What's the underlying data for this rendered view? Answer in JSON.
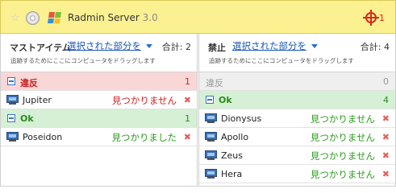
{
  "titlebar": {
    "app_name": "Radmin Server",
    "version": "3.0",
    "alert_count": "1"
  },
  "left_panel": {
    "label": "マストアイテム",
    "select_link": "選択された部分を",
    "total": "合計: 2",
    "hint": "追跡するためにここにコンピュータをドラッグします",
    "groups": [
      {
        "name": "違反",
        "count": "1",
        "items": [
          {
            "name": "Jupiter",
            "status": "見つかりません"
          }
        ]
      },
      {
        "name": "Ok",
        "count": "1",
        "items": [
          {
            "name": "Poseidon",
            "status": "見つかりました"
          }
        ]
      }
    ]
  },
  "right_panel": {
    "label": "禁止",
    "select_link": "選択された部分を",
    "total": "合計: 4",
    "hint": "追跡するためにここにコンピュータをドラッグします",
    "groups": [
      {
        "name": "違反",
        "count": "0",
        "items": []
      },
      {
        "name": "Ok",
        "count": "4",
        "items": [
          {
            "name": "Dionysus",
            "status": "見つかりません"
          },
          {
            "name": "Apollo",
            "status": "見つかりません"
          },
          {
            "name": "Zeus",
            "status": "見つかりません"
          },
          {
            "name": "Hera",
            "status": "見つかりません"
          }
        ]
      }
    ]
  },
  "icons": {
    "favorite": "star-icon",
    "server": "disc-icon",
    "os": "windows-logo-icon",
    "alert": "crosshair-alert-icon",
    "computer": "computer-icon",
    "remove": "remove-icon"
  },
  "colors": {
    "titlebar_bg": "#fbf191",
    "fail_red": "#cc2222",
    "ok_green": "#2b8a1c",
    "link_blue": "#1a58b6"
  }
}
